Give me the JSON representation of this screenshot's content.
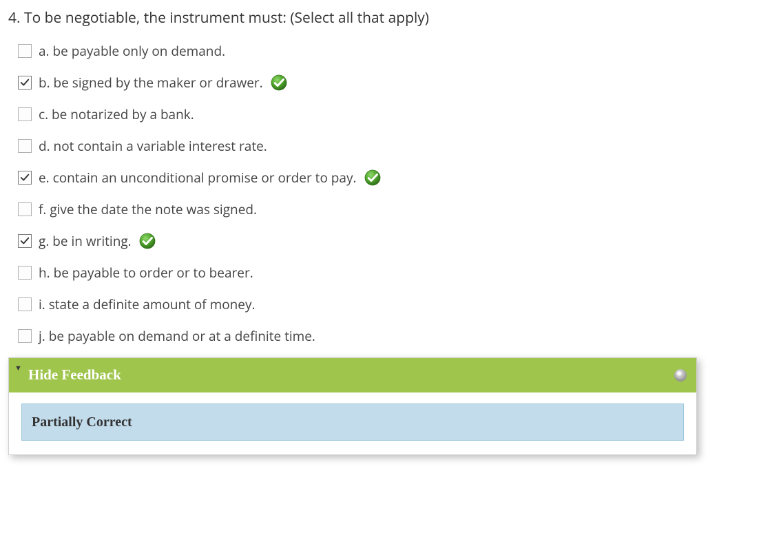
{
  "question": {
    "number": "4.",
    "text": "To be negotiable, the instrument must: (Select all that apply)"
  },
  "options": [
    {
      "letter": "a.",
      "text": "be payable only on demand.",
      "checked": false,
      "correct_mark": false
    },
    {
      "letter": "b.",
      "text": "be signed by the maker or drawer.",
      "checked": true,
      "correct_mark": true
    },
    {
      "letter": "c.",
      "text": "be notarized by a bank.",
      "checked": false,
      "correct_mark": false
    },
    {
      "letter": "d.",
      "text": "not contain a variable interest rate.",
      "checked": false,
      "correct_mark": false
    },
    {
      "letter": "e.",
      "text": "contain an unconditional promise or order to pay.",
      "checked": true,
      "correct_mark": true
    },
    {
      "letter": "f.",
      "text": "give the date the note was signed.",
      "checked": false,
      "correct_mark": false
    },
    {
      "letter": "g.",
      "text": "be in writing.",
      "checked": true,
      "correct_mark": true
    },
    {
      "letter": "h.",
      "text": "be payable to order or to bearer.",
      "checked": false,
      "correct_mark": false
    },
    {
      "letter": "i.",
      "text": "state a definite amount of money.",
      "checked": false,
      "correct_mark": false
    },
    {
      "letter": "j.",
      "text": "be payable on demand or at a definite time.",
      "checked": false,
      "correct_mark": false
    }
  ],
  "feedback": {
    "header_label": "Hide Feedback",
    "result_text": "Partially Correct"
  },
  "colors": {
    "header_bg": "#9fc54d",
    "result_bg": "#c3dceb"
  }
}
